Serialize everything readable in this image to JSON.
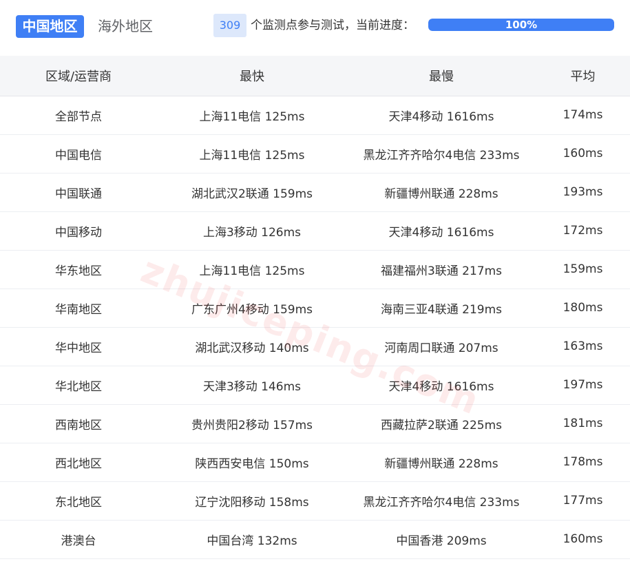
{
  "tabs": {
    "active": "中国地区",
    "inactive": "海外地区"
  },
  "status": {
    "count": "309",
    "text": "个监测点参与测试，当前进度：",
    "progress_label": "100%",
    "progress_fraction": 1.0
  },
  "table": {
    "headers": [
      "区域/运营商",
      "最快",
      "最慢",
      "平均"
    ],
    "rows": [
      [
        "全部节点",
        "上海11电信 125ms",
        "天津4移动 1616ms",
        "174ms"
      ],
      [
        "中国电信",
        "上海11电信 125ms",
        "黑龙江齐齐哈尔4电信 233ms",
        "160ms"
      ],
      [
        "中国联通",
        "湖北武汉2联通 159ms",
        "新疆博州联通 228ms",
        "193ms"
      ],
      [
        "中国移动",
        "上海3移动 126ms",
        "天津4移动 1616ms",
        "172ms"
      ],
      [
        "华东地区",
        "上海11电信 125ms",
        "福建福州3联通 217ms",
        "159ms"
      ],
      [
        "华南地区",
        "广东广州4移动 159ms",
        "海南三亚4联通 219ms",
        "180ms"
      ],
      [
        "华中地区",
        "湖北武汉移动 140ms",
        "河南周口联通 207ms",
        "163ms"
      ],
      [
        "华北地区",
        "天津3移动 146ms",
        "天津4移动 1616ms",
        "197ms"
      ],
      [
        "西南地区",
        "贵州贵阳2移动 157ms",
        "西藏拉萨2联通 225ms",
        "181ms"
      ],
      [
        "西北地区",
        "陕西西安电信 150ms",
        "新疆博州联通 228ms",
        "178ms"
      ],
      [
        "东北地区",
        "辽宁沈阳移动 158ms",
        "黑龙江齐齐哈尔4电信 233ms",
        "177ms"
      ],
      [
        "港澳台",
        "中国台湾 132ms",
        "中国香港 209ms",
        "160ms"
      ]
    ]
  },
  "watermark": "zhujiceping.com",
  "colors": {
    "accent": "#3f7ff5",
    "badge_bg": "#dde8fb",
    "header_bg": "#f5f6f8"
  }
}
